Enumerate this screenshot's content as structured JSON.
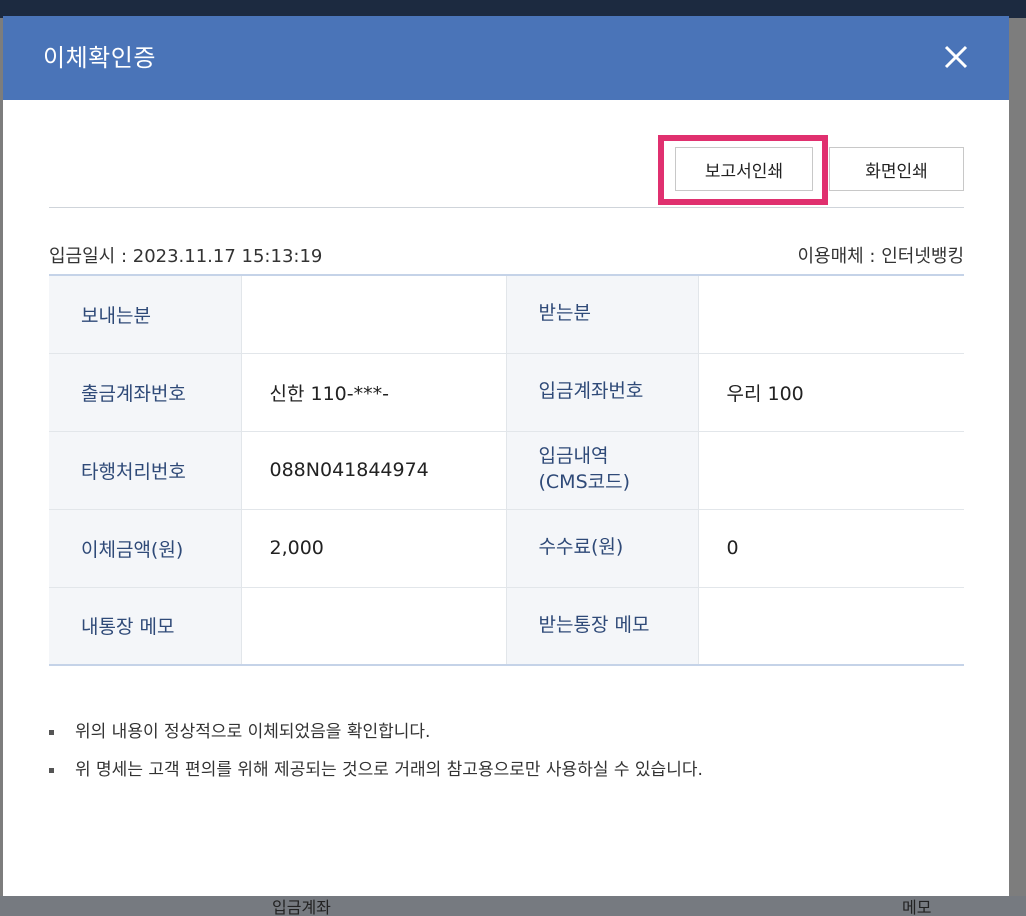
{
  "dialog": {
    "title": "이체확인증",
    "close_icon": "close-icon"
  },
  "toolbar": {
    "report_print_label": "보고서인쇄",
    "screen_print_label": "화면인쇄",
    "highlight_color": "#e0306f"
  },
  "meta": {
    "deposit_datetime": "입금일시 : 2023.11.17 15:13:19",
    "channel": "이용매체 : 인터넷뱅킹"
  },
  "details": {
    "rows": [
      {
        "left_label": "보내는분",
        "left_value": "",
        "right_label": "받는분",
        "right_value": ""
      },
      {
        "left_label": "출금계좌번호",
        "left_value": "신한 110-***-",
        "right_label": "입금계좌번호",
        "right_value": "우리 100"
      },
      {
        "left_label": "타행처리번호",
        "left_value": "088N041844974",
        "right_label": "입금내역\n(CMS코드)",
        "right_value": ""
      },
      {
        "left_label": "이체금액(원)",
        "left_value": "2,000",
        "right_label": "수수료(원)",
        "right_value": "0"
      },
      {
        "left_label": "내통장 메모",
        "left_value": "",
        "right_label": "받는통장 메모",
        "right_value": ""
      }
    ]
  },
  "notes": [
    "위의 내용이 정상적으로 이체되었음을 확인합니다.",
    "위 명세는 고객 편의를 위해 제공되는 것으로 거래의 참고용으로만 사용하실 수 있습니다."
  ],
  "background": {
    "bottom_items": [
      "입금계좌",
      "메모"
    ]
  },
  "colors": {
    "header": "#4a74b8",
    "label_text": "#2f4a78",
    "label_bg": "#f4f6f9"
  }
}
